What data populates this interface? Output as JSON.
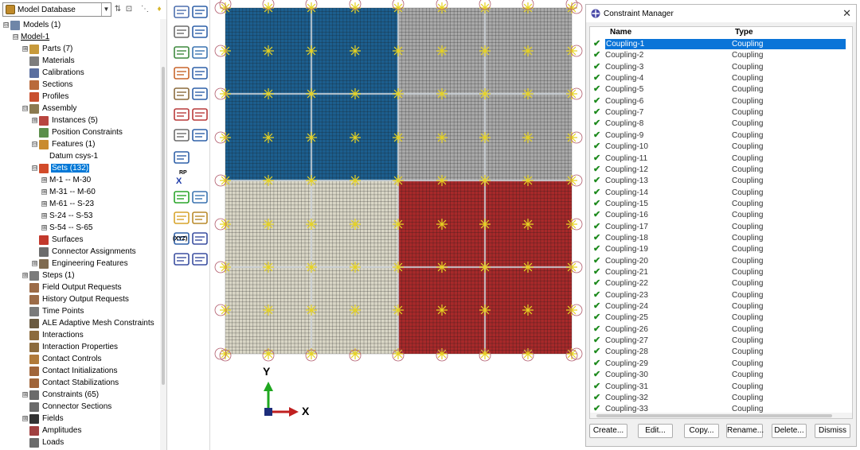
{
  "database": {
    "selected": "Model Database"
  },
  "tree": [
    {
      "label": "Models (1)",
      "depth": 0,
      "toggle": "⊟",
      "icon": "models-icon",
      "color": "#6f86a8"
    },
    {
      "label": "Model-1",
      "depth": 1,
      "toggle": "⊟",
      "icon": "",
      "color": "",
      "underline": true
    },
    {
      "label": "Parts (7)",
      "depth": 2,
      "toggle": "⊞",
      "icon": "parts-icon",
      "color": "#c79a3b"
    },
    {
      "label": "Materials",
      "depth": 2,
      "toggle": "",
      "icon": "materials-icon",
      "color": "#7d7d7d"
    },
    {
      "label": "Calibrations",
      "depth": 2,
      "toggle": "",
      "icon": "calibrations-icon",
      "color": "#5a6fa0"
    },
    {
      "label": "Sections",
      "depth": 2,
      "toggle": "",
      "icon": "sections-icon",
      "color": "#b96a3b"
    },
    {
      "label": "Profiles",
      "depth": 2,
      "toggle": "",
      "icon": "profiles-icon",
      "color": "#c9502f"
    },
    {
      "label": "Assembly",
      "depth": 2,
      "toggle": "⊟",
      "icon": "assembly-icon",
      "color": "#8c7a50"
    },
    {
      "label": "Instances (5)",
      "depth": 3,
      "toggle": "⊞",
      "icon": "instances-icon",
      "color": "#b8453f"
    },
    {
      "label": "Position Constraints",
      "depth": 3,
      "toggle": "",
      "icon": "position-constraints-icon",
      "color": "#5b8e4a"
    },
    {
      "label": "Features (1)",
      "depth": 3,
      "toggle": "⊟",
      "icon": "features-icon",
      "color": "#c98b2f"
    },
    {
      "label": "Datum csys-1",
      "depth": 4,
      "toggle": "",
      "icon": "",
      "color": ""
    },
    {
      "label": "Sets (132)",
      "depth": 3,
      "toggle": "⊟",
      "icon": "sets-icon",
      "color": "#d24b2a",
      "selected": true
    },
    {
      "label": "M-1 -- M-30",
      "depth": 4,
      "toggle": "⊞",
      "icon": "",
      "color": ""
    },
    {
      "label": "M-31 -- M-60",
      "depth": 4,
      "toggle": "⊞",
      "icon": "",
      "color": ""
    },
    {
      "label": "M-61 -- S-23",
      "depth": 4,
      "toggle": "⊞",
      "icon": "",
      "color": ""
    },
    {
      "label": "S-24 -- S-53",
      "depth": 4,
      "toggle": "⊞",
      "icon": "",
      "color": ""
    },
    {
      "label": "S-54 -- S-65",
      "depth": 4,
      "toggle": "⊞",
      "icon": "",
      "color": ""
    },
    {
      "label": "Surfaces",
      "depth": 3,
      "toggle": "",
      "icon": "surfaces-icon",
      "color": "#c2382b"
    },
    {
      "label": "Connector Assignments",
      "depth": 3,
      "toggle": "",
      "icon": "connector-assignments-icon",
      "color": "#6c6c6c"
    },
    {
      "label": "Engineering Features",
      "depth": 3,
      "toggle": "⊞",
      "icon": "engineering-features-icon",
      "color": "#7f6a4f"
    },
    {
      "label": "Steps (1)",
      "depth": 2,
      "toggle": "⊞",
      "icon": "steps-icon",
      "color": "#7b7b7b"
    },
    {
      "label": "Field Output Requests",
      "depth": 2,
      "toggle": "",
      "icon": "field-output-icon",
      "color": "#9c6b47"
    },
    {
      "label": "History Output Requests",
      "depth": 2,
      "toggle": "",
      "icon": "history-output-icon",
      "color": "#9c6b47"
    },
    {
      "label": "Time Points",
      "depth": 2,
      "toggle": "",
      "icon": "time-points-icon",
      "color": "#7a7a7a"
    },
    {
      "label": "ALE Adaptive Mesh Constraints",
      "depth": 2,
      "toggle": "",
      "icon": "ale-mesh-icon",
      "color": "#6a5a40"
    },
    {
      "label": "Interactions",
      "depth": 2,
      "toggle": "",
      "icon": "interactions-icon",
      "color": "#8c6b3d"
    },
    {
      "label": "Interaction Properties",
      "depth": 2,
      "toggle": "",
      "icon": "interaction-properties-icon",
      "color": "#8c6b3d"
    },
    {
      "label": "Contact Controls",
      "depth": 2,
      "toggle": "",
      "icon": "contact-controls-icon",
      "color": "#b07a3a"
    },
    {
      "label": "Contact Initializations",
      "depth": 2,
      "toggle": "",
      "icon": "contact-initializations-icon",
      "color": "#a0653a"
    },
    {
      "label": "Contact Stabilizations",
      "depth": 2,
      "toggle": "",
      "icon": "contact-stabilizations-icon",
      "color": "#a0653a"
    },
    {
      "label": "Constraints (65)",
      "depth": 2,
      "toggle": "⊞",
      "icon": "constraints-icon",
      "color": "#6b6b6b"
    },
    {
      "label": "Connector Sections",
      "depth": 2,
      "toggle": "",
      "icon": "connector-sections-icon",
      "color": "#6b6b6b"
    },
    {
      "label": "Fields",
      "depth": 2,
      "toggle": "⊞",
      "icon": "fields-icon",
      "color": "#333333"
    },
    {
      "label": "Amplitudes",
      "depth": 2,
      "toggle": "",
      "icon": "amplitudes-icon",
      "color": "#a04040"
    },
    {
      "label": "Loads",
      "depth": 2,
      "toggle": "",
      "icon": "loads-icon",
      "color": "#6b6b6b"
    }
  ],
  "toolbox": {
    "rp_label": "RP",
    "rp_axis": "X",
    "xyz_label": "(XYZ)",
    "tools": [
      "coupling-tool-icon",
      "constraint-manager-icon",
      "tie-tool-icon",
      "manager-icon",
      "mpc-tool-icon",
      "rigid-body-icon",
      "shell-solid-icon",
      "manager-icon-2",
      "embedded-icon",
      "manager-icon-3",
      "equation-icon",
      "display-body-icon",
      "connector-icon",
      "manager-icon-4",
      "reference-point-icon",
      "plus-icon",
      "wire-icon",
      "mesh-grid-icon",
      "partition-icon",
      "datum-csys-icon",
      "datum-axes-icon",
      "datum-point-icon",
      "triad-icon"
    ]
  },
  "viewport": {
    "axis_y_label": "Y",
    "axis_x_label": "X",
    "colors": {
      "blue": "#1c5e8e",
      "gray": "#a9a9a9",
      "beige": "#d9d6c6",
      "red": "#a7292a",
      "coupling": "#e7d321"
    }
  },
  "dialog": {
    "title": "Constraint Manager",
    "close": "✕",
    "col_name": "Name",
    "col_type": "Type",
    "check": "✔",
    "rows": [
      {
        "name": "Coupling-1",
        "type": "Coupling"
      },
      {
        "name": "Coupling-2",
        "type": "Coupling"
      },
      {
        "name": "Coupling-3",
        "type": "Coupling"
      },
      {
        "name": "Coupling-4",
        "type": "Coupling"
      },
      {
        "name": "Coupling-5",
        "type": "Coupling"
      },
      {
        "name": "Coupling-6",
        "type": "Coupling"
      },
      {
        "name": "Coupling-7",
        "type": "Coupling"
      },
      {
        "name": "Coupling-8",
        "type": "Coupling"
      },
      {
        "name": "Coupling-9",
        "type": "Coupling"
      },
      {
        "name": "Coupling-10",
        "type": "Coupling"
      },
      {
        "name": "Coupling-11",
        "type": "Coupling"
      },
      {
        "name": "Coupling-12",
        "type": "Coupling"
      },
      {
        "name": "Coupling-13",
        "type": "Coupling"
      },
      {
        "name": "Coupling-14",
        "type": "Coupling"
      },
      {
        "name": "Coupling-15",
        "type": "Coupling"
      },
      {
        "name": "Coupling-16",
        "type": "Coupling"
      },
      {
        "name": "Coupling-17",
        "type": "Coupling"
      },
      {
        "name": "Coupling-18",
        "type": "Coupling"
      },
      {
        "name": "Coupling-19",
        "type": "Coupling"
      },
      {
        "name": "Coupling-20",
        "type": "Coupling"
      },
      {
        "name": "Coupling-21",
        "type": "Coupling"
      },
      {
        "name": "Coupling-22",
        "type": "Coupling"
      },
      {
        "name": "Coupling-23",
        "type": "Coupling"
      },
      {
        "name": "Coupling-24",
        "type": "Coupling"
      },
      {
        "name": "Coupling-25",
        "type": "Coupling"
      },
      {
        "name": "Coupling-26",
        "type": "Coupling"
      },
      {
        "name": "Coupling-27",
        "type": "Coupling"
      },
      {
        "name": "Coupling-28",
        "type": "Coupling"
      },
      {
        "name": "Coupling-29",
        "type": "Coupling"
      },
      {
        "name": "Coupling-30",
        "type": "Coupling"
      },
      {
        "name": "Coupling-31",
        "type": "Coupling"
      },
      {
        "name": "Coupling-32",
        "type": "Coupling"
      },
      {
        "name": "Coupling-33",
        "type": "Coupling"
      }
    ],
    "selected_row": 0,
    "buttons": [
      "Create...",
      "Edit...",
      "Copy...",
      "Rename...",
      "Delete...",
      "Dismiss"
    ]
  }
}
